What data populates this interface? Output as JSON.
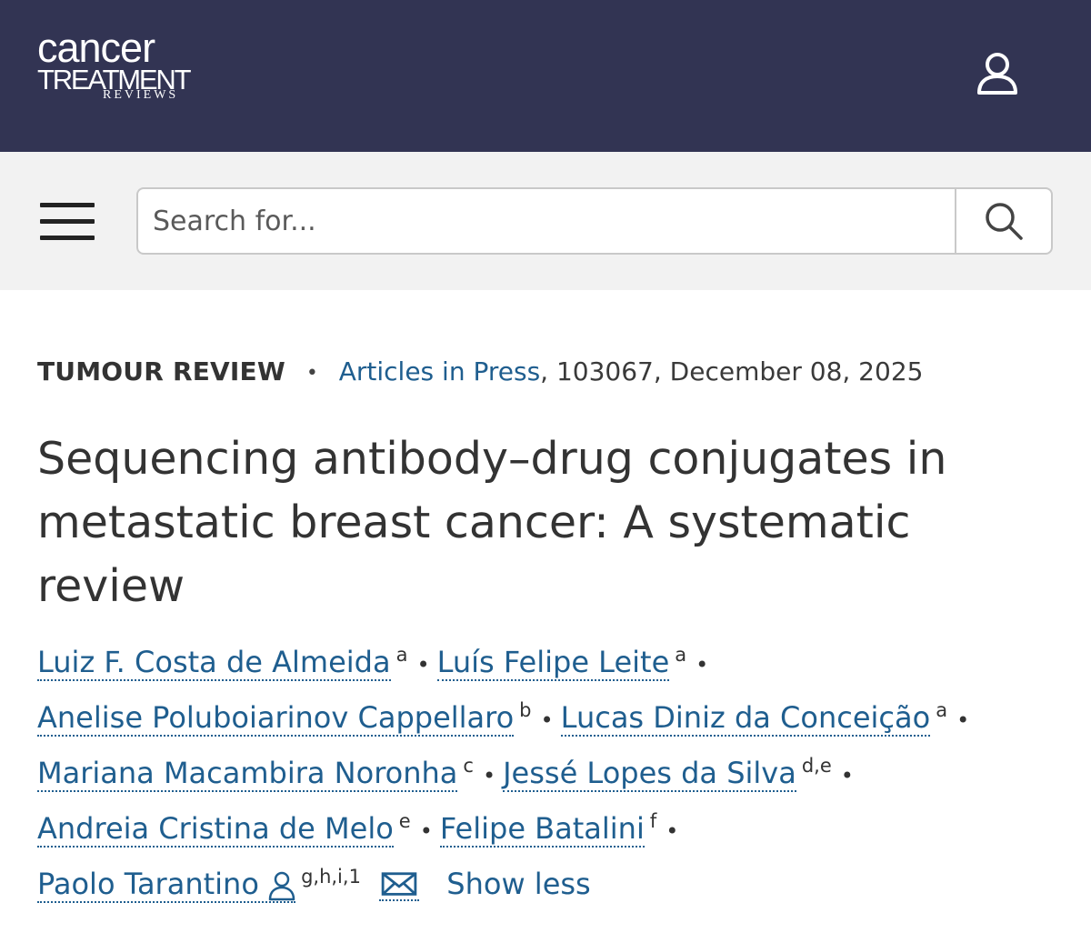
{
  "header": {
    "logo": {
      "line1": "cancer",
      "line2": "TREATMENT",
      "line3": "REVIEWS"
    },
    "user_icon": "user-account-icon",
    "background": "#323453"
  },
  "search": {
    "placeholder": "Search for...",
    "value": "",
    "menu_icon": "hamburger-menu-icon",
    "submit_icon": "search-icon"
  },
  "article": {
    "section": "TUMOUR REVIEW",
    "separator": "•",
    "issue_link": "Articles in Press",
    "issue_rest": ", 103067, December 08, 2025",
    "title": "Sequencing antibody–drug conjugates in metastatic breast cancer: A systematic review"
  },
  "authors": [
    {
      "name": "Luiz F. Costa de Almeida",
      "aff": "a"
    },
    {
      "name": "Luís Felipe Leite",
      "aff": "a"
    },
    {
      "name": "Anelise Poluboiarinov Cappellaro",
      "aff": "b"
    },
    {
      "name": "Lucas Diniz da Conceição",
      "aff": "a"
    },
    {
      "name": "Mariana Macambira Noronha",
      "aff": "c"
    },
    {
      "name": "Jessé Lopes da Silva",
      "aff": "d,e"
    },
    {
      "name": "Andreia Cristina de Melo",
      "aff": "e"
    },
    {
      "name": "Felipe Batalini",
      "aff": "f"
    },
    {
      "name": "Paolo Tarantino",
      "aff": "g,h,i,1",
      "corresponding": true
    }
  ],
  "author_separator": "•",
  "show_less_label": "Show less",
  "colors": {
    "link": "#1f5e8f",
    "text": "#333333",
    "search_band": "#f2f2f2"
  }
}
